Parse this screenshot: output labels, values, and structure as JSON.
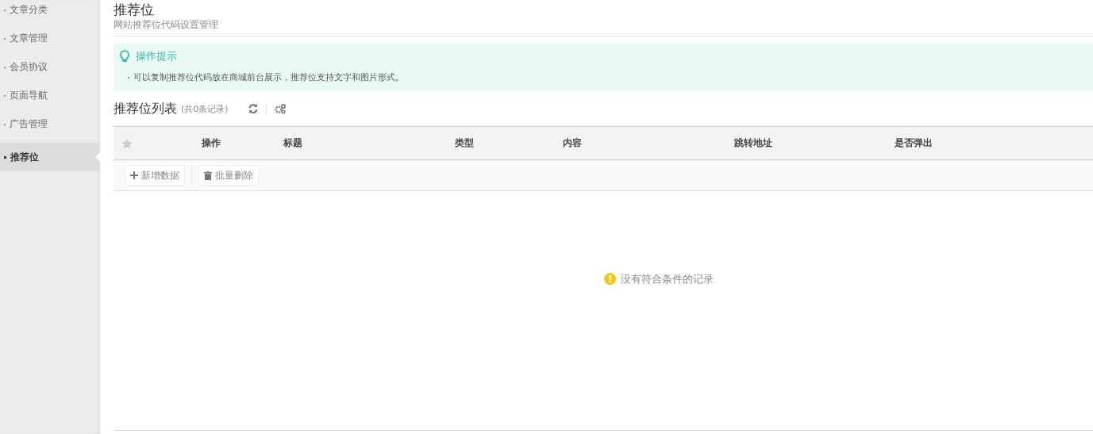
{
  "sidebar": {
    "items": [
      {
        "label": "文章分类",
        "selected": false
      },
      {
        "label": "文章管理",
        "selected": false
      },
      {
        "label": "会员协议",
        "selected": false
      },
      {
        "label": "页面导航",
        "selected": false
      },
      {
        "label": "广告管理",
        "selected": false
      },
      {
        "label": "推荐位",
        "selected": true
      }
    ]
  },
  "header": {
    "title": "推荐位",
    "subtitle": "网站推荐位代码设置管理"
  },
  "tips": {
    "title": "操作提示",
    "items": [
      "可以复制推荐位代码放在商城前台展示，推荐位支持文字和图片形式。"
    ]
  },
  "list": {
    "title": "推荐位列表",
    "count": "(共0条记录)"
  },
  "table": {
    "columns": [
      "操作",
      "标题",
      "类型",
      "内容",
      "跳转地址",
      "是否弹出"
    ],
    "toolbar": [
      {
        "kind": "add",
        "label": "新增数据"
      },
      {
        "kind": "delete",
        "label": "批量删除"
      }
    ],
    "empty": "没有符合条件的记录"
  }
}
